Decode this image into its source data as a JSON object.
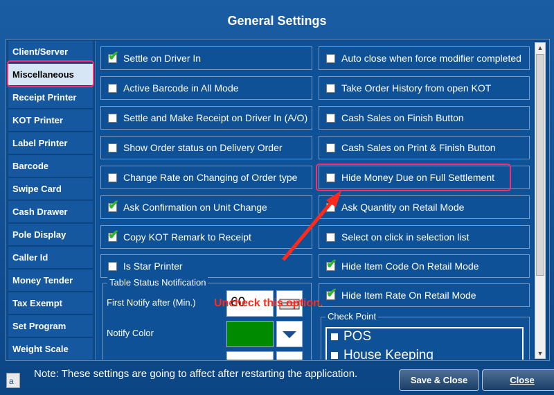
{
  "window": {
    "title": "General Settings"
  },
  "sidebar": {
    "items": [
      {
        "label": "Client/Server"
      },
      {
        "label": "Miscellaneous"
      },
      {
        "label": "Receipt Printer"
      },
      {
        "label": "KOT Printer"
      },
      {
        "label": "Label Printer"
      },
      {
        "label": "Barcode"
      },
      {
        "label": "Swipe Card"
      },
      {
        "label": "Cash Drawer"
      },
      {
        "label": "Pole Display"
      },
      {
        "label": "Caller Id"
      },
      {
        "label": "Money Tender"
      },
      {
        "label": "Tax Exempt"
      },
      {
        "label": "Set Program"
      },
      {
        "label": "Weight Scale"
      }
    ],
    "selected": "Miscellaneous"
  },
  "options_left": [
    {
      "label": "Settle on Driver In",
      "checked": true
    },
    {
      "label": "Active Barcode in All Mode",
      "checked": false
    },
    {
      "label": "Settle and Make Receipt on Driver In (A/O)",
      "checked": false
    },
    {
      "label": "Show Order status on Delivery Order",
      "checked": false
    },
    {
      "label": "Change Rate on Changing of Order type",
      "checked": false
    },
    {
      "label": "Ask Confirmation on Unit Change",
      "checked": true
    },
    {
      "label": "Copy KOT Remark to Receipt",
      "checked": true
    },
    {
      "label": "Is Star Printer",
      "checked": false
    }
  ],
  "options_right": [
    {
      "label": "Auto close when force modifier completed",
      "checked": false
    },
    {
      "label": "Take Order History from open KOT",
      "checked": false
    },
    {
      "label": "Cash Sales on Finish Button",
      "checked": false
    },
    {
      "label": "Cash Sales on Print & Finish Button",
      "checked": false
    },
    {
      "label": "Hide Money Due on Full Settlement",
      "checked": false
    },
    {
      "label": "Ask Quantity on Retail Mode",
      "checked": false
    },
    {
      "label": "Select on click in selection list",
      "checked": false
    },
    {
      "label": "Hide Item Code On Retail Mode",
      "checked": true
    },
    {
      "label": "Hide Item Rate On Retail Mode",
      "checked": true
    }
  ],
  "table_status": {
    "legend": "Table Status Notification",
    "first_notify_label": "First Notify after (Min.)",
    "first_notify_value": "60",
    "notify_color_label": "Notify Color",
    "notify_color": "#008a00"
  },
  "checkpoint": {
    "legend": "Check Point",
    "items": [
      "POS",
      "House Keeping"
    ]
  },
  "annotation": {
    "text": "Uncheck this option.",
    "color": "#ff2a1a"
  },
  "footer": {
    "note": "Note: These settings are going to affect after restarting the application.",
    "save_close": "Save & Close",
    "close": "Close"
  },
  "colors": {
    "highlight": "#ff2a6d",
    "check": "#2fb52f",
    "background": "#0b4a8a"
  }
}
